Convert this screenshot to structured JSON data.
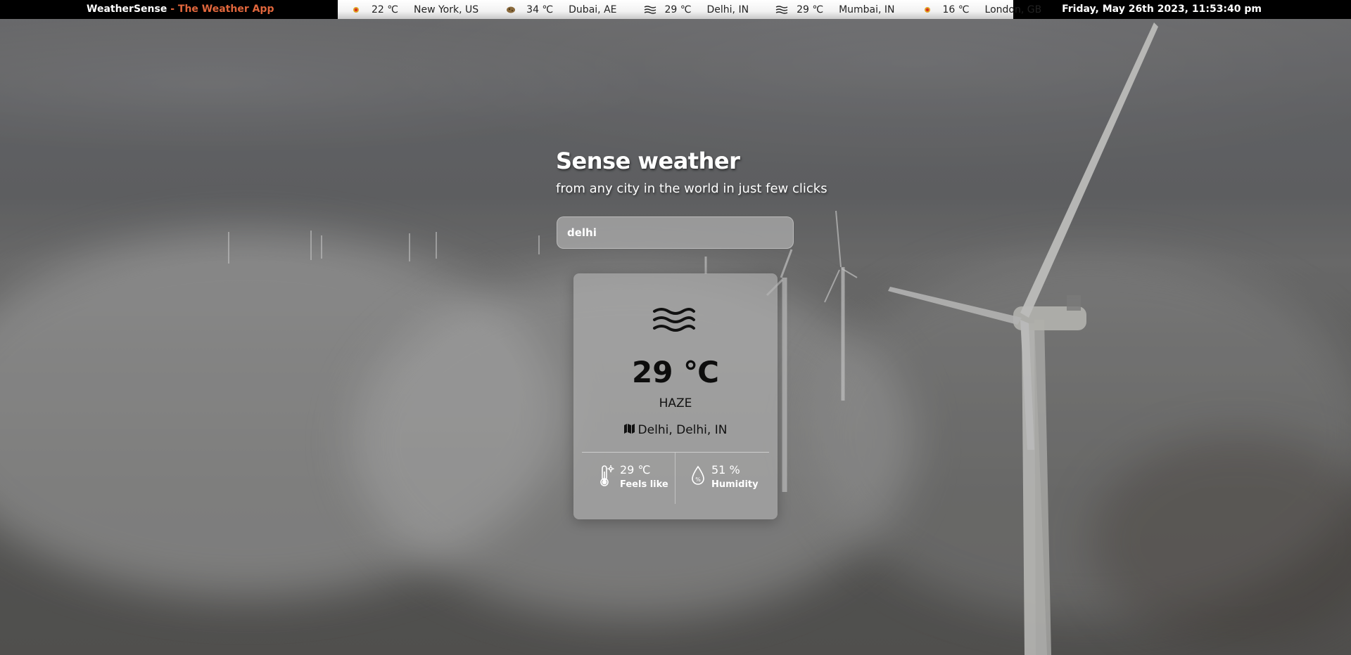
{
  "app": {
    "brand_name": "WeatherSense",
    "brand_sep": " - ",
    "brand_tagline": "The Weather App"
  },
  "ticker": [
    {
      "icon": "sun-icon",
      "temp": "22 ℃",
      "city": "New York, US"
    },
    {
      "icon": "dust-icon",
      "temp": "34 ℃",
      "city": "Dubai, AE"
    },
    {
      "icon": "haze-icon",
      "temp": "29 ℃",
      "city": "Delhi, IN"
    },
    {
      "icon": "haze-icon",
      "temp": "29 ℃",
      "city": "Mumbai, IN"
    },
    {
      "icon": "sun-icon",
      "temp": "16 ℃",
      "city": "London, GB"
    }
  ],
  "datetime": "Friday, May 26th 2023, 11:53:40 pm",
  "hero": {
    "title": "Sense weather",
    "subtitle": "from any city in the world in just few clicks"
  },
  "search": {
    "value": "delhi"
  },
  "card": {
    "icon": "haze-icon",
    "temperature": "29 ℃",
    "condition": "HAZE",
    "location": "Delhi, Delhi, IN",
    "feels_like_value": "29 ℃",
    "feels_like_label": "Feels like",
    "humidity_value": "51 %",
    "humidity_label": "Humidity"
  },
  "colors": {
    "accent": "#e0663c",
    "topbar": "#000000",
    "card_bg": "rgba(175,175,175,0.66)"
  }
}
